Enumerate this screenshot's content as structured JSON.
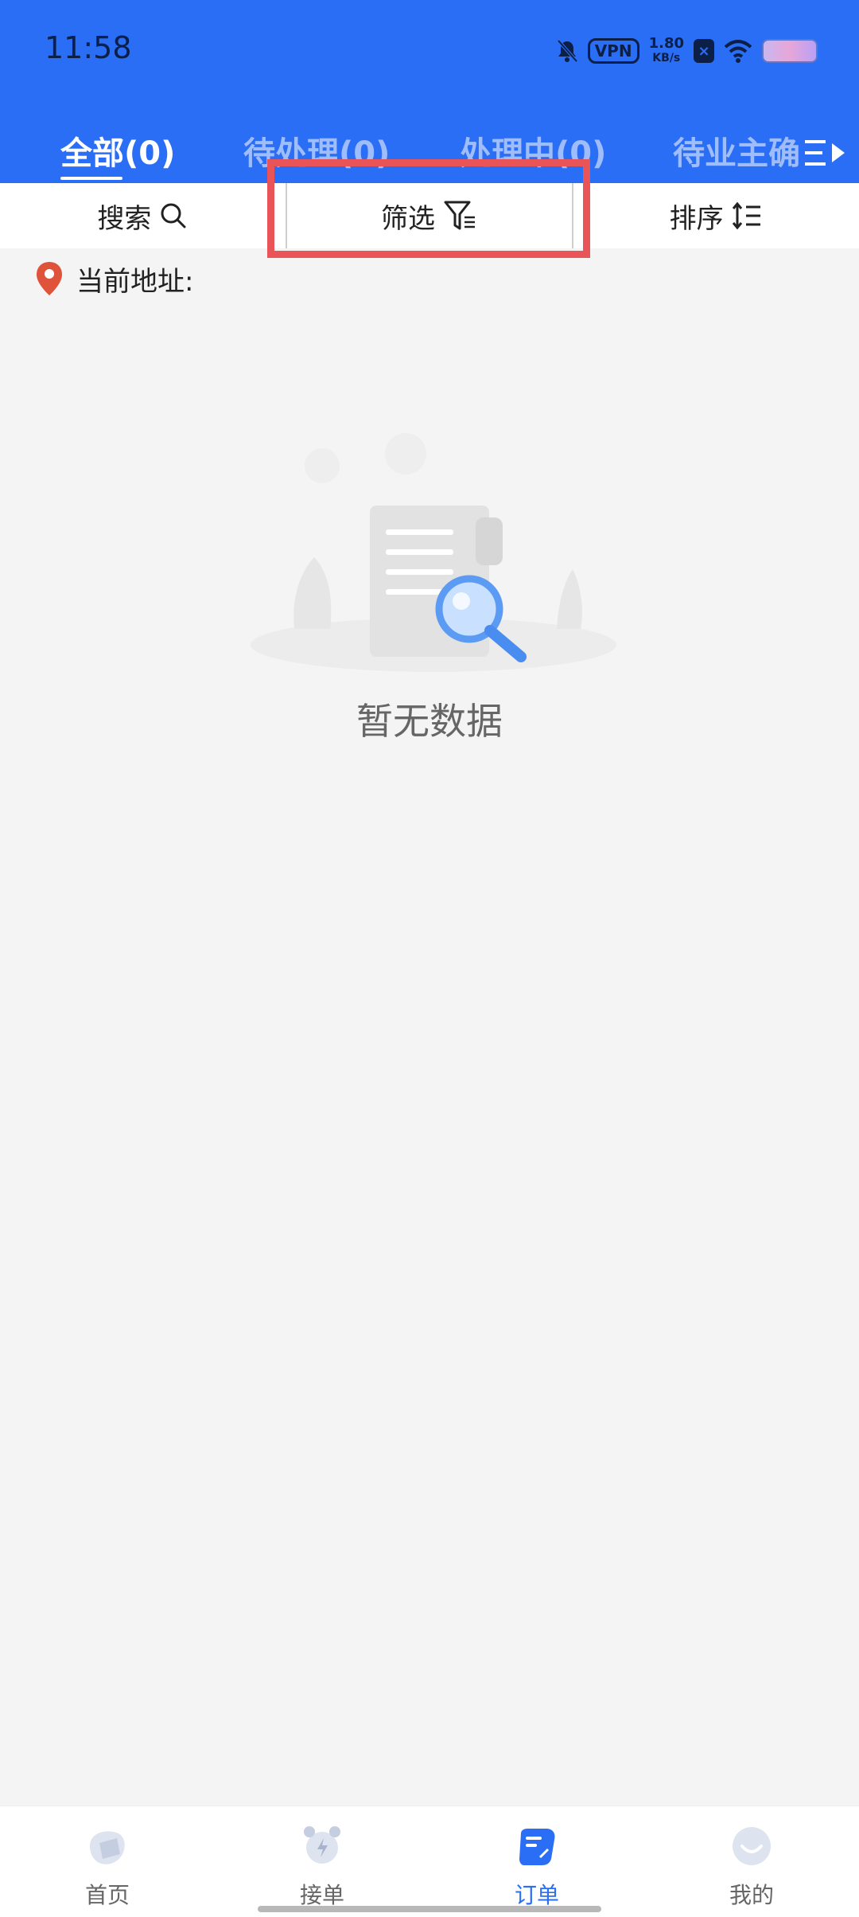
{
  "status_bar": {
    "time": "11:58",
    "vpn": "VPN",
    "speed_value": "1.80",
    "speed_unit": "KB/s",
    "icons": [
      "bell-off-icon",
      "vpn-badge",
      "speed-indicator",
      "x-app-icon",
      "wifi-icon",
      "battery-icon"
    ]
  },
  "tabs": [
    {
      "label": "全部(0)",
      "active": true
    },
    {
      "label": "待处理(0)",
      "active": false
    },
    {
      "label": "处理中(0)",
      "active": false
    },
    {
      "label": "待业主确",
      "active": false
    }
  ],
  "tabs_more_icon": "expand-tabs-icon",
  "toolbar": {
    "search_label": "搜索",
    "filter_label": "筛选",
    "sort_label": "排序"
  },
  "address": {
    "label": "当前地址:"
  },
  "empty_state": {
    "text": "暂无数据"
  },
  "bottom_nav": [
    {
      "label": "首页",
      "icon": "home-icon",
      "active": false
    },
    {
      "label": "接单",
      "icon": "alarm-icon",
      "active": false
    },
    {
      "label": "订单",
      "icon": "order-icon",
      "active": true
    },
    {
      "label": "我的",
      "icon": "profile-icon",
      "active": false
    }
  ],
  "colors": {
    "primary": "#2b6ef6",
    "highlight": "#e85457",
    "background": "#f4f4f4"
  }
}
